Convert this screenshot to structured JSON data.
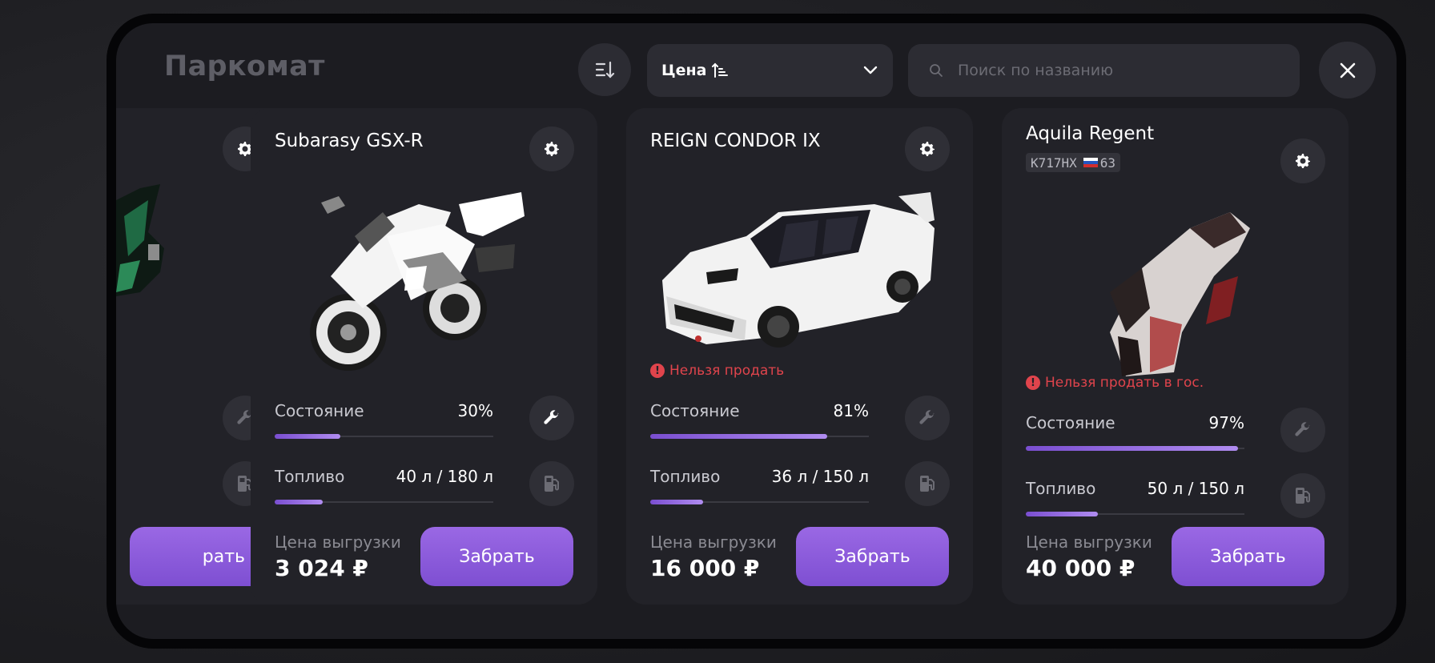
{
  "header": {
    "title": "Паркомат",
    "sort_select_value": "Цена",
    "search_placeholder": "Поиск по названию"
  },
  "card_labels": {
    "condition": "Состояние",
    "fuel": "Топливо",
    "unload_price": "Цена выгрузки",
    "take_button": "Забрать"
  },
  "partial_card": {
    "take_button_visible": "рать"
  },
  "cards": [
    {
      "name": "Subarasy GSX-R",
      "condition": "30%",
      "condition_value": 0.3,
      "fuel": "40 л / 180 л",
      "fuel_value": 0.22,
      "price": "3 024 ₽"
    },
    {
      "name": "REIGN CONDOR IX",
      "warning": "Нельзя продать",
      "condition": "81%",
      "condition_value": 0.81,
      "fuel": "36 л / 150 л",
      "fuel_value": 0.24,
      "price": "16 000 ₽"
    },
    {
      "name": "Aquila Regent",
      "plate_number": "K717HX",
      "plate_region": "63",
      "warning": "Нельзя продать в гос.",
      "condition": "97%",
      "condition_value": 0.97,
      "fuel": "50 л / 150 л",
      "fuel_value": 0.33,
      "price": "40 000 ₽"
    }
  ],
  "colors": {
    "accent": "#8a5ad8",
    "warning": "#e0444c",
    "panel": "#1c1c21",
    "card": "#222228"
  }
}
